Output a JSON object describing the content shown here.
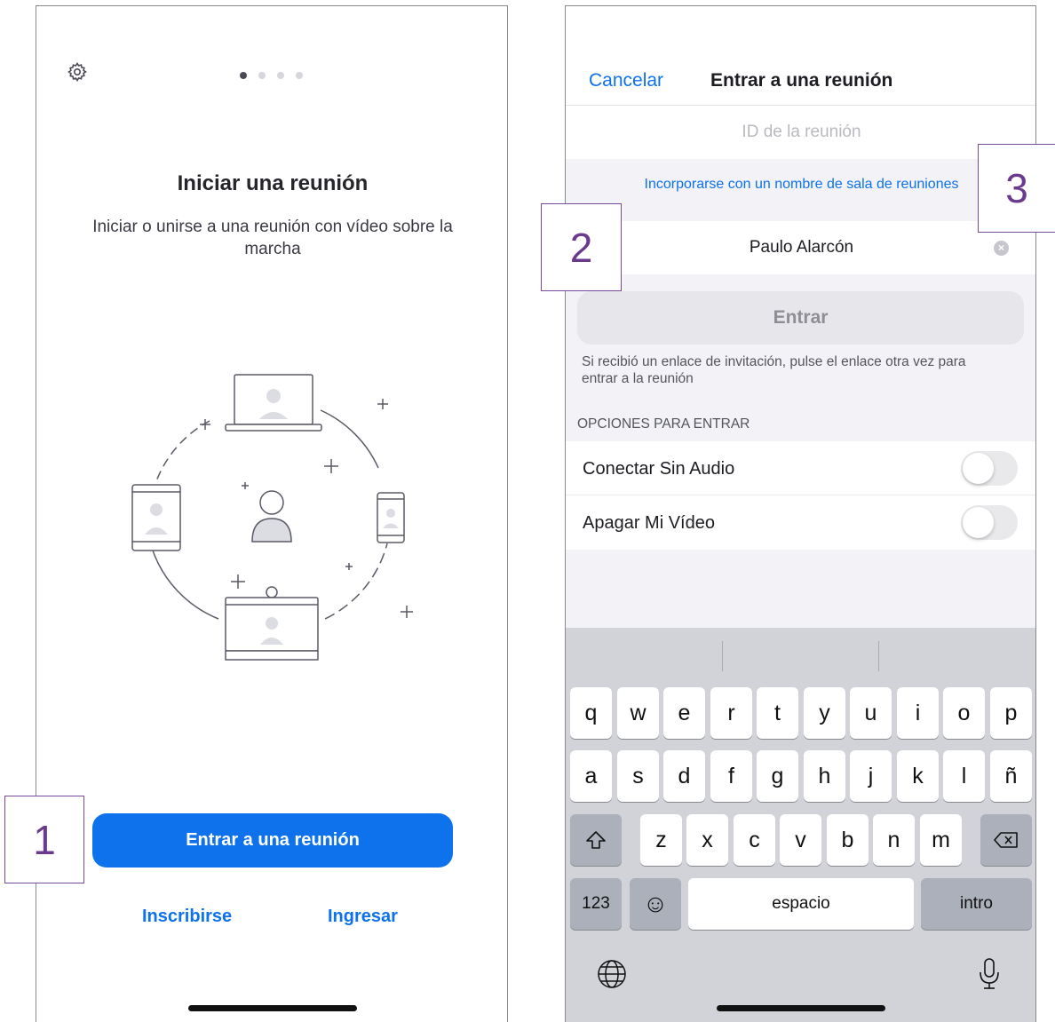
{
  "left_screen": {
    "pager": {
      "total": 4,
      "active": 1
    },
    "title": "Iniciar una reunión",
    "subtitle": "Iniciar o unirse a una reunión con vídeo sobre la marcha",
    "join_button": "Entrar a una reunión",
    "signup_link": "Inscribirse",
    "login_link": "Ingresar",
    "icons": {
      "settings": "gear-icon",
      "illustration": "meeting-network-illustration"
    }
  },
  "right_screen": {
    "nav": {
      "cancel": "Cancelar",
      "title": "Entrar a una reunión"
    },
    "meeting_id": {
      "value": "",
      "placeholder": "ID de la reunión"
    },
    "room_name_link": "Incorporarse con un nombre de sala de reuniones",
    "display_name": "Paulo Alarcón",
    "enter_button": "Entrar",
    "hint": "Si recibió un enlace de invitación, pulse el enlace otra vez para entrar a la reunión",
    "options_header": "OPCIONES PARA ENTRAR",
    "options": [
      {
        "label": "Conectar Sin Audio",
        "enabled": false
      },
      {
        "label": "Apagar Mi Vídeo",
        "enabled": false
      }
    ],
    "keyboard": {
      "row1": [
        "q",
        "w",
        "e",
        "r",
        "t",
        "y",
        "u",
        "i",
        "o",
        "p"
      ],
      "row2": [
        "a",
        "s",
        "d",
        "f",
        "g",
        "h",
        "j",
        "k",
        "l",
        "ñ"
      ],
      "row3": [
        "z",
        "x",
        "c",
        "v",
        "b",
        "n",
        "m"
      ],
      "numbers_key": "123",
      "space_key": "espacio",
      "return_key": "intro",
      "emoji_glyph": "☺",
      "globe_glyph": "🌐",
      "mic_glyph": "🎙"
    }
  },
  "annotations": [
    "1",
    "2",
    "3"
  ],
  "colors": {
    "accent": "#0e72ed",
    "annotation": "#6b3a8e"
  }
}
